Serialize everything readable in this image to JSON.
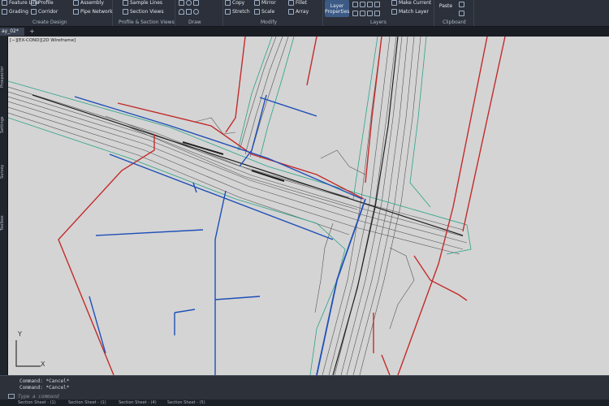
{
  "ribbon": {
    "create_design": {
      "items": [
        "Feature Line",
        "Profile",
        "Assembly",
        "Grading",
        "Corridor",
        "Pipe Network"
      ],
      "title": "Create Design"
    },
    "profile_section": {
      "items": [
        "Sample Lines",
        "Section Views"
      ],
      "title": "Profile & Section Views"
    },
    "draw": {
      "title": "Draw"
    },
    "modify": {
      "items": [
        "Copy",
        "Mirror",
        "Fillet",
        "Stretch",
        "Scale",
        "Array"
      ],
      "title": "Modify"
    },
    "layers": {
      "big_button": "Layer Properties",
      "items": [
        "Make Current",
        "Match Layer"
      ],
      "title": "Layers"
    },
    "clipboard": {
      "big_button": "Paste",
      "title": "Clipboard"
    }
  },
  "tabs": {
    "file_tab": "ay_02*",
    "add_tab": "+"
  },
  "left_palettes": [
    "Prospector",
    "Settings",
    "Survey",
    "Toolbox"
  ],
  "viewport": {
    "label": "[−][EX-COND][2D Wireframe]",
    "ucs_x": "X",
    "ucs_y": "Y"
  },
  "command": {
    "history": [
      "Command: *Cancel*",
      "Command: *Cancel*"
    ],
    "placeholder": "Type a command"
  },
  "layout_tabs": [
    "Section Sheet - (1)",
    "Section Sheet - (1)",
    "Section Sheet - (4)",
    "Section Sheet - (5)"
  ],
  "colors": {
    "property_line": "#c42b2b",
    "pipe_network": "#1f4fb8",
    "contour": "#4a4a4a",
    "daylight": "#2aa287",
    "viewport_bg": "#d4d4d4"
  }
}
